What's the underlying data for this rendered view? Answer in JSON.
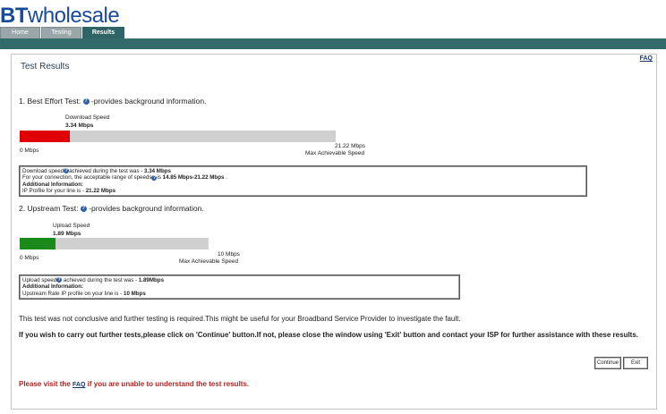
{
  "header": {
    "logo_bt": "BT",
    "logo_rest": "wholesale",
    "tabs": [
      {
        "label": "Home"
      },
      {
        "label": "Testing"
      },
      {
        "label": "Results"
      }
    ],
    "colors": {
      "brand": "#1a4a9c",
      "navbar": "#336b6b",
      "active_tab": "#2f6366"
    }
  },
  "panel": {
    "faq": "FAQ",
    "title": "Test Results",
    "best_effort": {
      "heading_pre": "1. Best Effort Test:",
      "heading_post": "-provides background information.",
      "bar_caption": "Download Speed",
      "speed": "3.34 Mbps",
      "speed_fraction": 0.1574,
      "fill_color": "#e00000",
      "min_label": "0 Mbps",
      "max_value": "21.22 Mbps",
      "max_caption": "Max Achievable Speed",
      "info_l1_pre": "Download speed",
      "info_l1_mid": "achieved during the test was - ",
      "info_l1_val": "3.34 Mbps",
      "info_l2_pre": "For your connection, the acceptable range of speeds",
      "info_l2_mid": "is ",
      "info_l2_val": "14.85 Mbps-21.22 Mbps",
      "info_l2_end": " .",
      "info_l3": "Additional Information:",
      "info_l4_pre": "IP Profile for your line is - ",
      "info_l4_val": "21.22 Mbps"
    },
    "upstream": {
      "heading_pre": "2. Upstream Test:",
      "heading_post": "-provides background information.",
      "bar_caption": "Upload Speed",
      "speed": "1.89 Mbps",
      "speed_fraction": 0.189,
      "fill_color": "#1a8a1a",
      "min_label": "0 Mbps",
      "max_value": "10 Mbps",
      "max_caption": "Max Achievable Speed",
      "info_l1_pre": "Upload speed",
      "info_l1_mid": " achieved during the test was - ",
      "info_l1_val": "1.89Mbps",
      "info_l2": "Additional Information:",
      "info_l3_pre": "Upstream Rate IP profile on your line is - ",
      "info_l3_val": "10 Mbps"
    },
    "note": "This test was not conclusive and further testing is required.This might be useful for your Broadband Service Provider to investigate the fault.",
    "instruction": "If you wish to carry out further tests,please click on 'Continue' button.If not, please close the window using 'Exit' button and contact your ISP for further assistance with these results.",
    "continue_label": "Continue",
    "exit_label": "Exit",
    "help_pre": "Please visit the ",
    "help_link": "FAQ",
    "help_post": " if you are unable to understand the test results."
  }
}
